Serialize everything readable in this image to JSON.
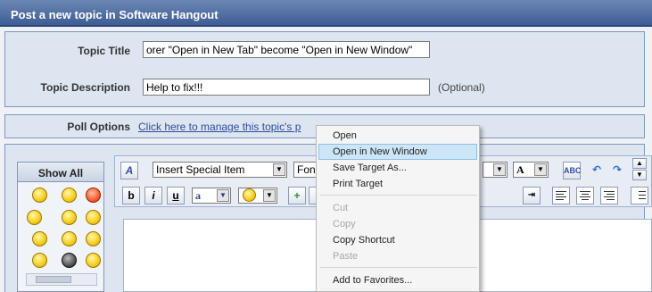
{
  "header": {
    "title": "Post a new topic in Software Hangout"
  },
  "form": {
    "topic_title_label": "Topic Title",
    "topic_title_value": "orer \"Open in New Tab\" become \"Open in New Window\"",
    "topic_description_label": "Topic Description",
    "topic_description_value": "Help to fix!!!",
    "optional_note": "(Optional)",
    "poll_label": "Poll Options",
    "poll_link": "Click here to manage this topic's p"
  },
  "emoticons": {
    "show_all": "Show All"
  },
  "toolbar": {
    "special_item": "Insert Special Item",
    "font_select": "Fon",
    "bold": "b",
    "italic": "i",
    "underline": "u",
    "font_color": "a",
    "fontsize_icon": "A"
  },
  "context_menu": {
    "items": [
      {
        "label": "Open",
        "state": "enabled"
      },
      {
        "label": "Open in New Window",
        "state": "highlighted"
      },
      {
        "label": "Save Target As...",
        "state": "enabled"
      },
      {
        "label": "Print Target",
        "state": "enabled"
      },
      {
        "label": "Cut",
        "state": "disabled"
      },
      {
        "label": "Copy",
        "state": "disabled"
      },
      {
        "label": "Copy Shortcut",
        "state": "enabled"
      },
      {
        "label": "Paste",
        "state": "disabled"
      },
      {
        "label": "Add to Favorites...",
        "state": "enabled"
      }
    ]
  },
  "colors": {
    "title_bar": "#3e5d95",
    "panel_bg": "#dde5f0",
    "highlight": "#cde6f7",
    "link": "#2e4d9a"
  }
}
